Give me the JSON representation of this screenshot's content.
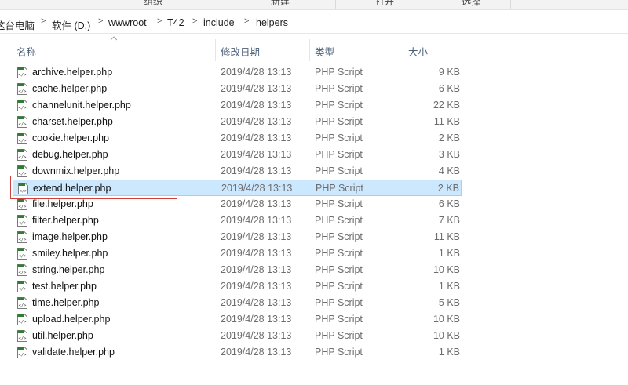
{
  "ribbon": {
    "items": [
      "组织",
      "新建",
      "打开",
      "选择"
    ]
  },
  "address_bar": {
    "crumbs": [
      "这台电脑",
      "软件 (D:)",
      "wwwroot",
      "T42",
      "include",
      "helpers"
    ]
  },
  "columns": {
    "name": "名称",
    "date": "修改日期",
    "type": "类型",
    "size": "大小"
  },
  "files": [
    {
      "name": "archive.helper.php",
      "date": "2019/4/28 13:13",
      "type": "PHP Script",
      "size": "9 KB"
    },
    {
      "name": "cache.helper.php",
      "date": "2019/4/28 13:13",
      "type": "PHP Script",
      "size": "6 KB"
    },
    {
      "name": "channelunit.helper.php",
      "date": "2019/4/28 13:13",
      "type": "PHP Script",
      "size": "22 KB"
    },
    {
      "name": "charset.helper.php",
      "date": "2019/4/28 13:13",
      "type": "PHP Script",
      "size": "11 KB"
    },
    {
      "name": "cookie.helper.php",
      "date": "2019/4/28 13:13",
      "type": "PHP Script",
      "size": "2 KB"
    },
    {
      "name": "debug.helper.php",
      "date": "2019/4/28 13:13",
      "type": "PHP Script",
      "size": "3 KB"
    },
    {
      "name": "downmix.helper.php",
      "date": "2019/4/28 13:13",
      "type": "PHP Script",
      "size": "4 KB"
    },
    {
      "name": "extend.helper.php",
      "date": "2019/4/28 13:13",
      "type": "PHP Script",
      "size": "2 KB",
      "selected": true
    },
    {
      "name": "file.helper.php",
      "date": "2019/4/28 13:13",
      "type": "PHP Script",
      "size": "6 KB"
    },
    {
      "name": "filter.helper.php",
      "date": "2019/4/28 13:13",
      "type": "PHP Script",
      "size": "7 KB"
    },
    {
      "name": "image.helper.php",
      "date": "2019/4/28 13:13",
      "type": "PHP Script",
      "size": "11 KB"
    },
    {
      "name": "smiley.helper.php",
      "date": "2019/4/28 13:13",
      "type": "PHP Script",
      "size": "1 KB"
    },
    {
      "name": "string.helper.php",
      "date": "2019/4/28 13:13",
      "type": "PHP Script",
      "size": "10 KB"
    },
    {
      "name": "test.helper.php",
      "date": "2019/4/28 13:13",
      "type": "PHP Script",
      "size": "1 KB"
    },
    {
      "name": "time.helper.php",
      "date": "2019/4/28 13:13",
      "type": "PHP Script",
      "size": "5 KB"
    },
    {
      "name": "upload.helper.php",
      "date": "2019/4/28 13:13",
      "type": "PHP Script",
      "size": "10 KB"
    },
    {
      "name": "util.helper.php",
      "date": "2019/4/28 13:13",
      "type": "PHP Script",
      "size": "10 KB"
    },
    {
      "name": "validate.helper.php",
      "date": "2019/4/28 13:13",
      "type": "PHP Script",
      "size": "1 KB"
    }
  ],
  "colors": {
    "selection_bg": "#cce8ff",
    "selection_border": "#99d1ff",
    "annotation_red": "#d23f3f"
  },
  "icons": {
    "file": "php-file-icon",
    "sort": "sort-ascending-icon",
    "separator": "chevron-right-icon"
  }
}
